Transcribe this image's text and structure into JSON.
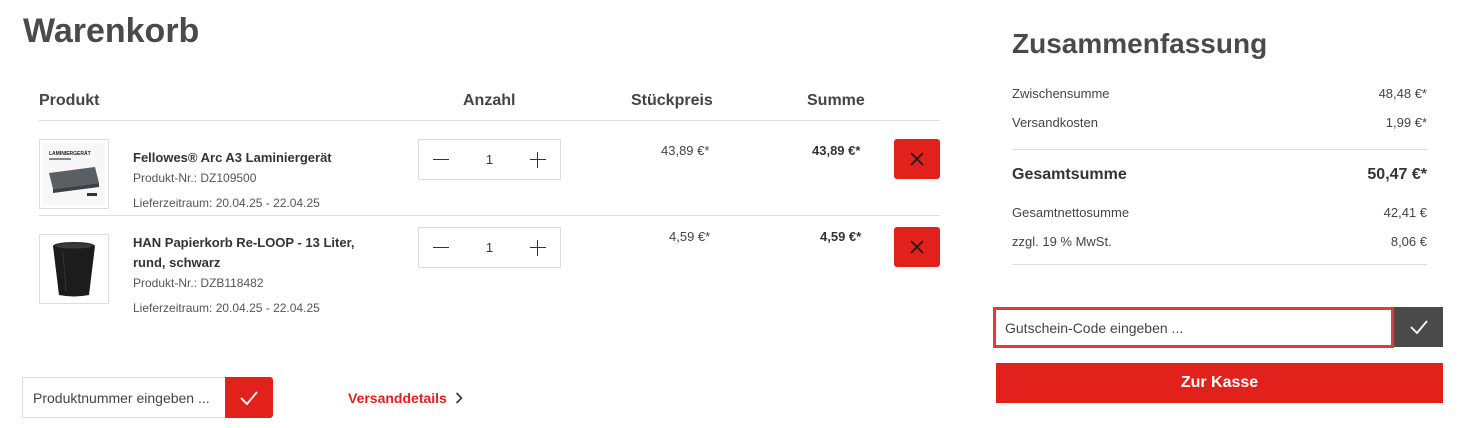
{
  "page": {
    "title": "Warenkorb"
  },
  "cart": {
    "headers": {
      "product": "Produkt",
      "quantity": "Anzahl",
      "unit_price": "Stückpreis",
      "sum": "Summe"
    },
    "items": [
      {
        "name": "Fellowes® Arc A3 Laminiergerät",
        "sku": "Produkt-Nr.: DZ109500",
        "delivery": "Lieferzeitraum: 20.04.25 - 22.04.25",
        "quantity": "1",
        "unit_price": "43,89 €*",
        "sum": "43,89 €*",
        "thumb_icon": "laminator-image",
        "thumb_text": "LAMINIERGERÄT"
      },
      {
        "name": "HAN Papierkorb Re-LOOP - 13 Liter, rund, schwarz",
        "sku": "Produkt-Nr.: DZB118482",
        "delivery": "Lieferzeitraum: 20.04.25 - 22.04.25",
        "quantity": "1",
        "unit_price": "4,59 €*",
        "sum": "4,59 €*",
        "thumb_icon": "waste-bin-image"
      }
    ],
    "sku_form": {
      "placeholder": "Produktnummer eingeben ..."
    },
    "shipping_link": "Versanddetails"
  },
  "summary": {
    "title": "Zusammenfassung",
    "subtotal_label": "Zwischensumme",
    "subtotal_value": "48,48 €*",
    "shipping_label": "Versandkosten",
    "shipping_value": "1,99 €*",
    "total_label": "Gesamtsumme",
    "total_value": "50,47 €*",
    "net_label": "Gesamtnettosumme",
    "net_value": "42,41 €",
    "vat_label": "zzgl. 19 % MwSt.",
    "vat_value": "8,06 €",
    "voucher_placeholder": "Gutschein-Code eingeben ...",
    "checkout_label": "Zur Kasse"
  },
  "colors": {
    "accent": "#e2211c",
    "dark_button": "#4a4a4a",
    "border": "#dddddd",
    "highlight": "#e23a3a"
  }
}
